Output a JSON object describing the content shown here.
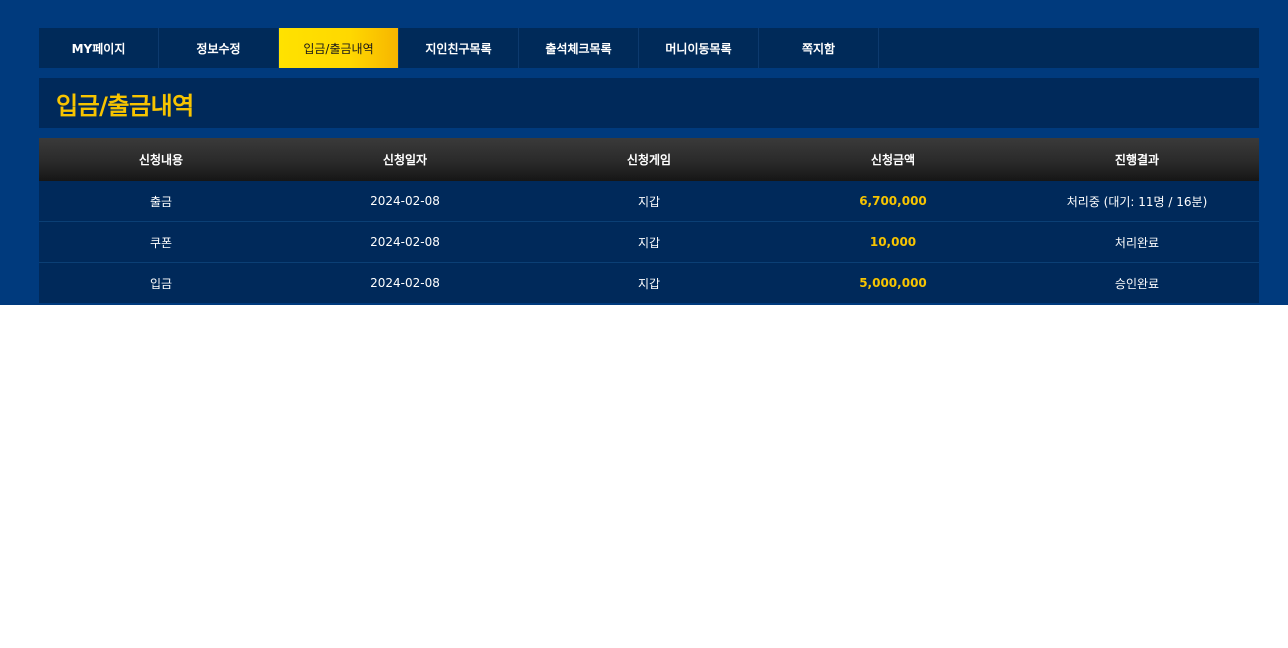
{
  "nav": {
    "tabs": [
      {
        "label": "MY페이지",
        "active": false
      },
      {
        "label": "정보수정",
        "active": false
      },
      {
        "label": "입금/출금내역",
        "active": true
      },
      {
        "label": "지인친구목록",
        "active": false
      },
      {
        "label": "출석체크목록",
        "active": false
      },
      {
        "label": "머니이동목록",
        "active": false
      },
      {
        "label": "쪽지함",
        "active": false
      }
    ]
  },
  "page": {
    "title": "입금/출금내역"
  },
  "table": {
    "columns": [
      "신청내용",
      "신청일자",
      "신청게임",
      "신청금액",
      "진행결과"
    ],
    "rows": [
      [
        "출금",
        "2024-02-08",
        "지갑",
        "6,700,000",
        "처리중 (대기: 11명 / 16분)"
      ],
      [
        "쿠폰",
        "2024-02-08",
        "지갑",
        "10,000",
        "처리완료"
      ],
      [
        "입금",
        "2024-02-08",
        "지갑",
        "5,000,000",
        "승인완료"
      ]
    ]
  },
  "colors": {
    "background": "#003a7d",
    "panel": "#00295a",
    "accent": "#f7c400",
    "active_tab": "#ffe200"
  }
}
